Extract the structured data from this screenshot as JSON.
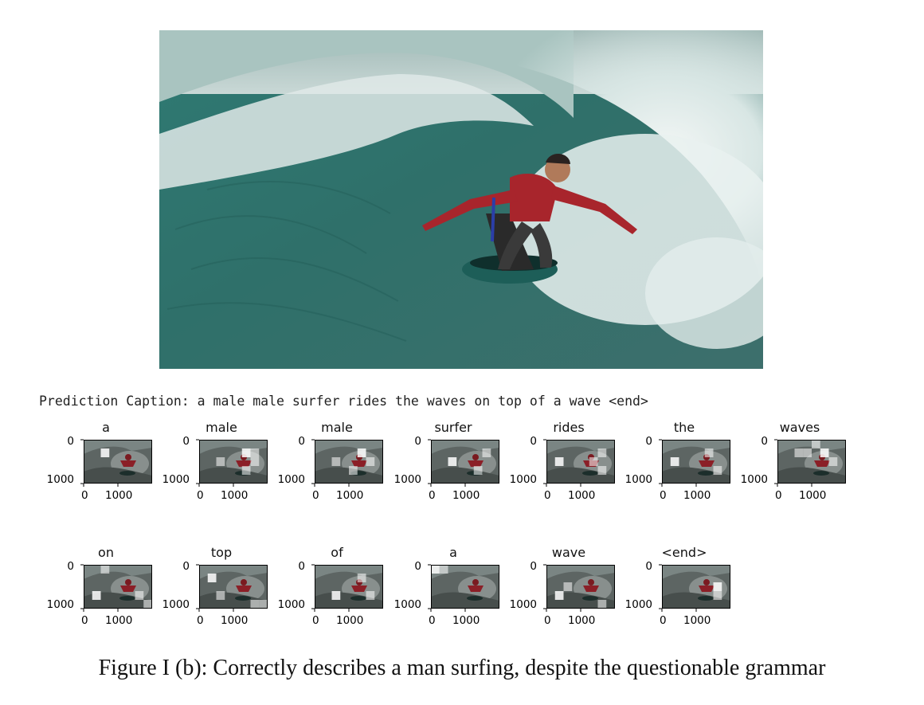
{
  "prediction_line": "Prediction Caption: a male male surfer rides the waves on top of a wave <end>",
  "tick_labels": {
    "y_top": "0",
    "y_bottom": "1000",
    "x_left": "0",
    "x_right": "1000"
  },
  "attention_words": [
    "a",
    "male",
    "male",
    "surfer",
    "rides",
    "the",
    "waves",
    "on",
    "top",
    "of",
    "a",
    "wave",
    "<end>"
  ],
  "figure_caption": "Figure I (b): Correctly describes a man surfing, despite the questionable grammar"
}
